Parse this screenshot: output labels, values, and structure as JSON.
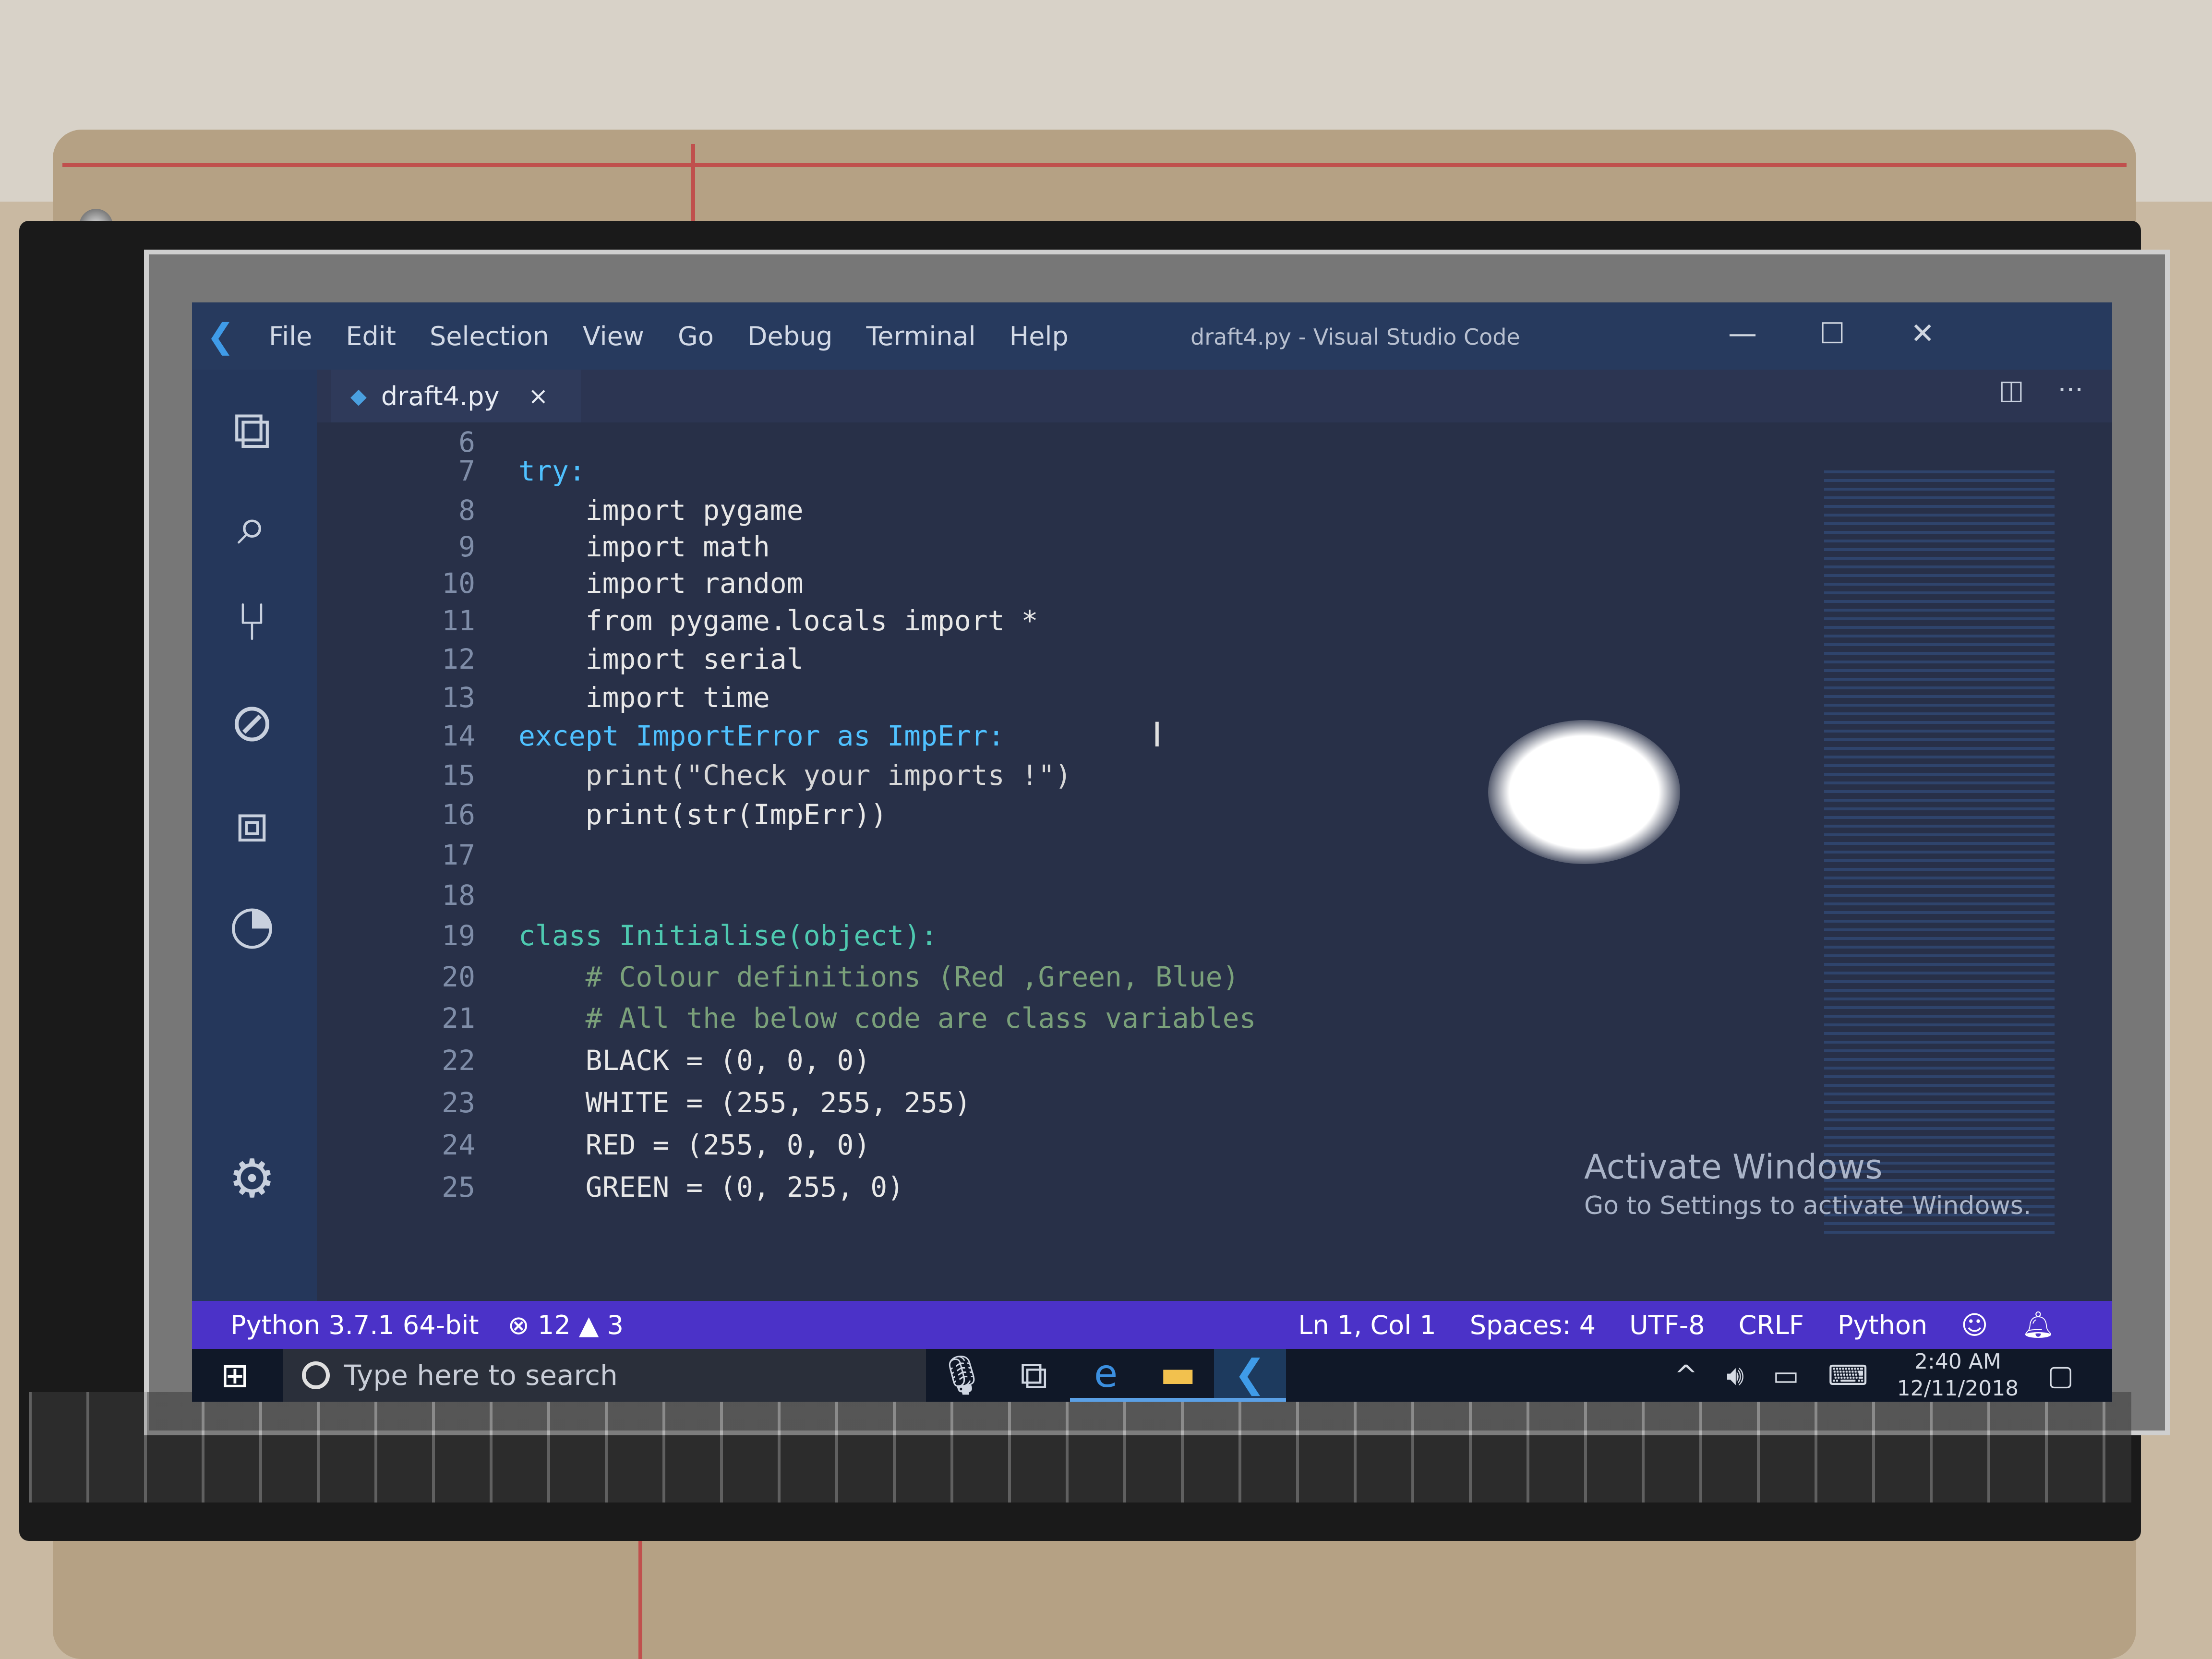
{
  "window": {
    "title": "draft4.py - Visual Studio Code",
    "menu": [
      "File",
      "Edit",
      "Selection",
      "View",
      "Go",
      "Debug",
      "Terminal",
      "Help"
    ],
    "minimize": "—",
    "maximize": "☐",
    "close": "✕"
  },
  "activity_bar": {
    "icons": [
      "explorer-icon",
      "search-icon",
      "source-control-icon",
      "extensions-debug-icon",
      "extensions-icon",
      "remote-icon"
    ],
    "settings_icon": "gear-icon"
  },
  "tab": {
    "label": "draft4.py",
    "close": "×",
    "icon": "python-file-icon"
  },
  "editor_actions": [
    "split-editor-icon",
    "more-actions-icon"
  ],
  "code": [
    {
      "n": "6",
      "text": ""
    },
    {
      "n": "7",
      "text": "try:"
    },
    {
      "n": "8",
      "text": "    import pygame"
    },
    {
      "n": "9",
      "text": "    import math"
    },
    {
      "n": "10",
      "text": "    import random"
    },
    {
      "n": "11",
      "text": "    from pygame.locals import *"
    },
    {
      "n": "12",
      "text": "    import serial"
    },
    {
      "n": "13",
      "text": "    import time"
    },
    {
      "n": "14",
      "text": "except ImportError as ImpErr:"
    },
    {
      "n": "15",
      "text": "    print(\"Check your imports !\")"
    },
    {
      "n": "16",
      "text": "    print(str(ImpErr))"
    },
    {
      "n": "17",
      "text": ""
    },
    {
      "n": "18",
      "text": ""
    },
    {
      "n": "19",
      "text": "class Initialise(object):"
    },
    {
      "n": "20",
      "text": "    # Colour definitions (Red ,Green, Blue)"
    },
    {
      "n": "21",
      "text": "    # All the below code are class variables"
    },
    {
      "n": "22",
      "text": "    BLACK = (0, 0, 0)"
    },
    {
      "n": "23",
      "text": "    WHITE = (255, 255, 255)"
    },
    {
      "n": "24",
      "text": "    RED = (255, 0, 0)"
    },
    {
      "n": "25",
      "text": "    GREEN = (0, 255, 0)"
    }
  ],
  "watermark": {
    "title": "Activate Windows",
    "subtitle": "Go to Settings to activate Windows."
  },
  "status_bar": {
    "interpreter": "Python 3.7.1 64-bit",
    "errors": "12",
    "warnings": "3",
    "position": "Ln 1, Col 1",
    "spaces": "Spaces: 4",
    "encoding": "UTF-8",
    "eol": "CRLF",
    "language": "Python",
    "color": "#4b32c8"
  },
  "taskbar": {
    "search_placeholder": "Type here to search",
    "time": "2:40 AM",
    "date": "12/11/2018",
    "apps": [
      "microphone-icon",
      "task-view-icon",
      "edge-icon",
      "file-explorer-icon",
      "vscode-icon"
    ]
  }
}
